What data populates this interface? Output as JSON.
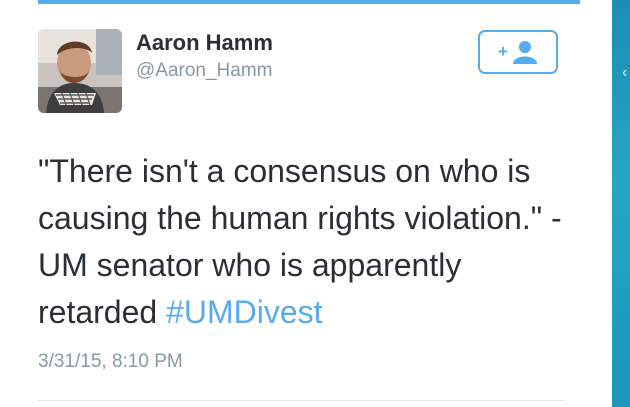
{
  "tweet": {
    "author": {
      "display_name": "Aaron Hamm",
      "handle": "@Aaron_Hamm",
      "avatar_icon": "profile-photo"
    },
    "follow_button": {
      "icon": "follow-user-icon",
      "symbol": "+"
    },
    "text_before_hashtag": "\"There isn't a consensus on who is causing the human rights violation.\" -UM senator who is apparently retarded ",
    "hashtag": "#UMDivest",
    "timestamp": "3/31/15, 8:10 PM"
  },
  "colors": {
    "accent": "#55acee",
    "text": "#292f33",
    "muted": "#8899a6",
    "divider": "#e1e8ed",
    "edge": "#1b8db3"
  }
}
